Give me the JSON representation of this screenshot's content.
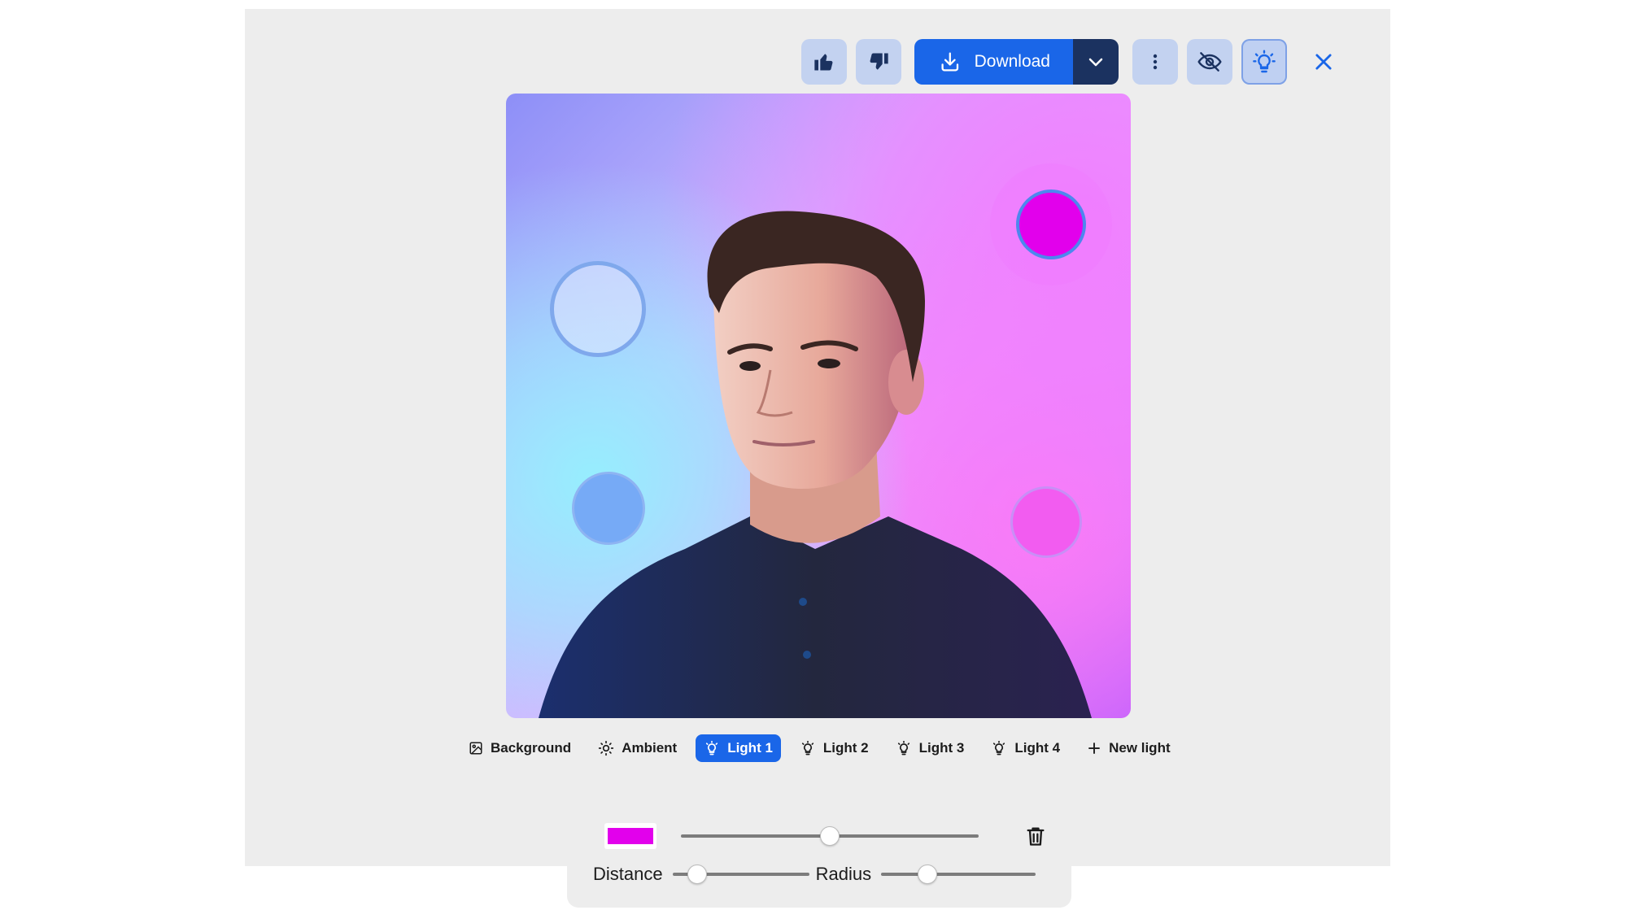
{
  "toolbar": {
    "download_label": "Download",
    "thumbs_up_icon": "thumbs-up-icon",
    "thumbs_down_icon": "thumbs-down-icon",
    "more_icon": "more-vertical-icon",
    "hide_icon": "eye-off-icon",
    "light_icon": "lightbulb-icon",
    "close_icon": "close-icon"
  },
  "tabs": [
    {
      "label": "Background",
      "icon": "image-icon"
    },
    {
      "label": "Ambient",
      "icon": "sun-icon"
    },
    {
      "label": "Light 1",
      "icon": "lightbulb-icon",
      "active": true
    },
    {
      "label": "Light 2",
      "icon": "lightbulb-icon"
    },
    {
      "label": "Light 3",
      "icon": "lightbulb-icon"
    },
    {
      "label": "Light 4",
      "icon": "lightbulb-icon"
    },
    {
      "label": "New light",
      "icon": "plus-icon"
    }
  ],
  "controls": {
    "color": "#e200ec",
    "intensity": 0.5,
    "distance_label": "Distance",
    "distance": 0.18,
    "radius_label": "Radius",
    "radius": 0.3
  },
  "colors": {
    "accent": "#1a66e8",
    "download_arrow_bg": "#1b3260",
    "light_1": "#e200ec",
    "light_3": "#76aaf6",
    "light_4": "#f25cf0"
  }
}
